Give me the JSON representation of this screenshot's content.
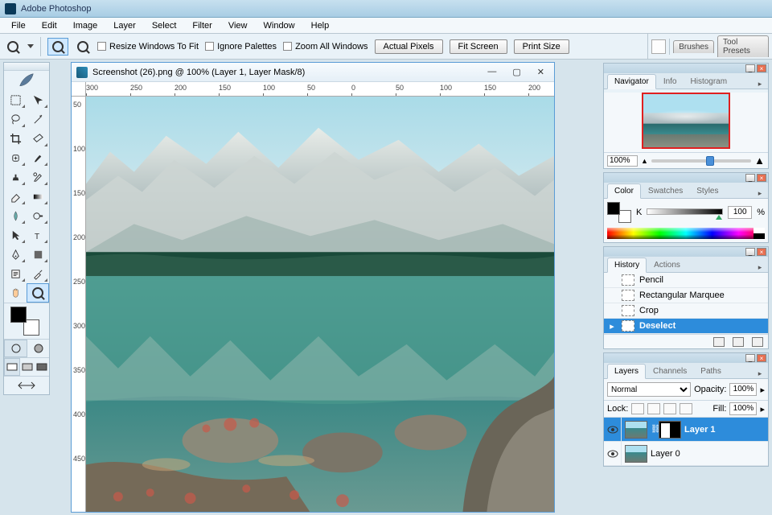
{
  "app": {
    "title": "Adobe Photoshop"
  },
  "menu": [
    "File",
    "Edit",
    "Image",
    "Layer",
    "Select",
    "Filter",
    "View",
    "Window",
    "Help"
  ],
  "options": {
    "resize_fit": "Resize Windows To Fit",
    "ignore_palettes": "Ignore Palettes",
    "zoom_all": "Zoom All Windows",
    "actual_pixels": "Actual Pixels",
    "fit_screen": "Fit Screen",
    "print_size": "Print Size"
  },
  "dock": {
    "brushes": "Brushes",
    "tool_presets": "Tool Presets"
  },
  "document": {
    "title": "Screenshot (26).png @ 100% (Layer 1, Layer Mask/8)",
    "ruler_h": [
      "300",
      "250",
      "200",
      "150",
      "100",
      "50",
      "0",
      "50",
      "100",
      "150",
      "200"
    ],
    "ruler_v": [
      "50",
      "100",
      "150",
      "200",
      "250",
      "300",
      "350",
      "400",
      "450"
    ]
  },
  "navigator": {
    "tabs": [
      "Navigator",
      "Info",
      "Histogram"
    ],
    "zoom": "100%"
  },
  "color": {
    "tabs": [
      "Color",
      "Swatches",
      "Styles"
    ],
    "channel": "K",
    "value": "100",
    "pct": "%"
  },
  "history": {
    "tabs": [
      "History",
      "Actions"
    ],
    "items": [
      "Pencil",
      "Rectangular Marquee",
      "Crop",
      "Deselect"
    ],
    "selected": 3
  },
  "layers": {
    "tabs": [
      "Layers",
      "Channels",
      "Paths"
    ],
    "blend": "Normal",
    "opacity_label": "Opacity:",
    "opacity": "100%",
    "lock_label": "Lock:",
    "fill_label": "Fill:",
    "fill": "100%",
    "items": [
      {
        "name": "Layer 1",
        "mask": true,
        "selected": true
      },
      {
        "name": "Layer 0",
        "mask": false,
        "selected": false
      }
    ]
  }
}
